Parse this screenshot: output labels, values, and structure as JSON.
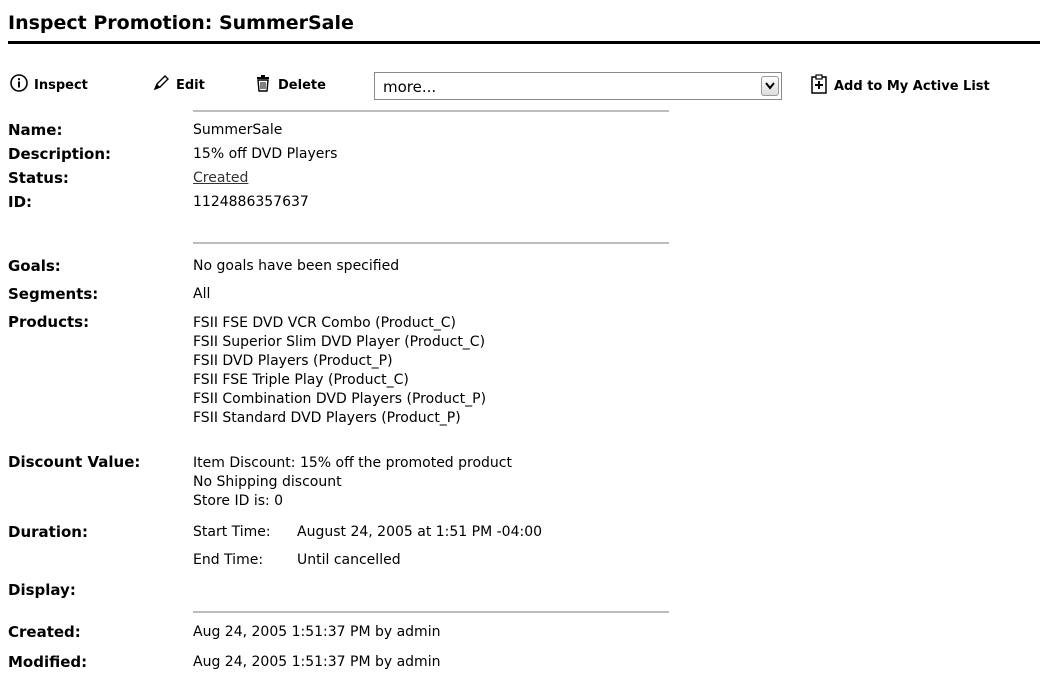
{
  "page": {
    "title": "Inspect Promotion: SummerSale"
  },
  "toolbar": {
    "inspect": {
      "label": "Inspect",
      "icon": "info-icon"
    },
    "edit": {
      "label": "Edit",
      "icon": "pencil-icon"
    },
    "delete": {
      "label": "Delete",
      "icon": "trash-icon"
    },
    "more_select": {
      "value": "more...",
      "icon": "chevron-down-icon"
    },
    "add_list": {
      "label": "Add to My Active List",
      "icon": "clipboard-add-icon"
    }
  },
  "fields": {
    "name": {
      "label": "Name:",
      "value": "SummerSale"
    },
    "description": {
      "label": "Description:",
      "value": "15% off DVD Players"
    },
    "status": {
      "label": "Status:",
      "value": "Created"
    },
    "id": {
      "label": "ID:",
      "value": "1124886357637"
    },
    "goals": {
      "label": "Goals:",
      "value": "No goals have been specified"
    },
    "segments": {
      "label": "Segments:",
      "value": "All"
    },
    "products": {
      "label": "Products:",
      "values": [
        "FSII FSE DVD VCR Combo (Product_C)",
        "FSII Superior Slim DVD Player (Product_C)",
        "FSII DVD Players (Product_P)",
        "FSII FSE Triple Play (Product_C)",
        "FSII Combination DVD Players (Product_P)",
        "FSII Standard DVD Players (Product_P)"
      ]
    },
    "discount": {
      "label": "Discount Value:",
      "values": [
        "Item Discount: 15% off the promoted product",
        "No Shipping discount",
        "Store ID is: 0"
      ]
    },
    "duration": {
      "label": "Duration:",
      "start_label": "Start Time:",
      "start_value": "August 24, 2005 at 1:51 PM -04:00",
      "end_label": "End Time:",
      "end_value": "Until cancelled"
    },
    "display": {
      "label": "Display:",
      "value": ""
    },
    "created": {
      "label": "Created:",
      "value": "Aug 24, 2005 1:51:37 PM by admin"
    },
    "modified": {
      "label": "Modified:",
      "value": "Aug 24, 2005 1:51:37 PM by admin"
    }
  }
}
